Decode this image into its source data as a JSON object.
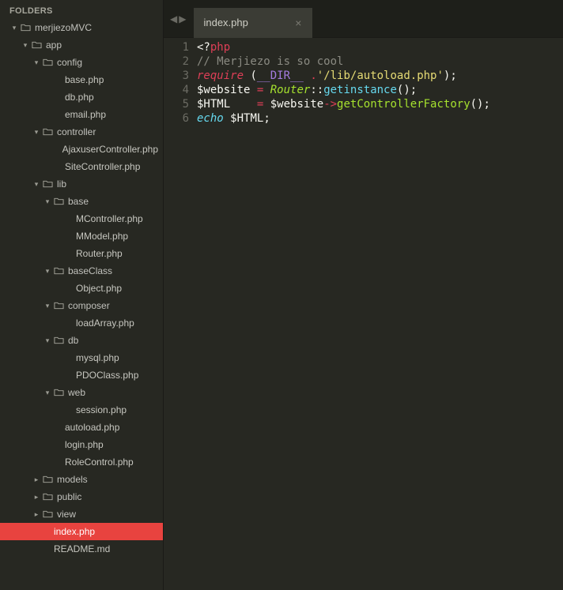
{
  "sidebar": {
    "header": "FOLDERS",
    "tree": [
      {
        "type": "folder",
        "open": true,
        "depth": 0,
        "label": "merjiezoMVC"
      },
      {
        "type": "folder",
        "open": true,
        "depth": 1,
        "label": "app"
      },
      {
        "type": "folder",
        "open": true,
        "depth": 2,
        "label": "config"
      },
      {
        "type": "file",
        "depth": 3,
        "label": "base.php"
      },
      {
        "type": "file",
        "depth": 3,
        "label": "db.php"
      },
      {
        "type": "file",
        "depth": 3,
        "label": "email.php"
      },
      {
        "type": "folder",
        "open": true,
        "depth": 2,
        "label": "controller"
      },
      {
        "type": "file",
        "depth": 3,
        "label": "AjaxuserController.php"
      },
      {
        "type": "file",
        "depth": 3,
        "label": "SiteController.php"
      },
      {
        "type": "folder",
        "open": true,
        "depth": 2,
        "label": "lib"
      },
      {
        "type": "folder",
        "open": true,
        "depth": 3,
        "label": "base"
      },
      {
        "type": "file",
        "depth": 4,
        "label": "MController.php"
      },
      {
        "type": "file",
        "depth": 4,
        "label": "MModel.php"
      },
      {
        "type": "file",
        "depth": 4,
        "label": "Router.php"
      },
      {
        "type": "folder",
        "open": true,
        "depth": 3,
        "label": "baseClass"
      },
      {
        "type": "file",
        "depth": 4,
        "label": "Object.php"
      },
      {
        "type": "folder",
        "open": true,
        "depth": 3,
        "label": "composer"
      },
      {
        "type": "file",
        "depth": 4,
        "label": "loadArray.php"
      },
      {
        "type": "folder",
        "open": true,
        "depth": 3,
        "label": "db"
      },
      {
        "type": "file",
        "depth": 4,
        "label": "mysql.php"
      },
      {
        "type": "file",
        "depth": 4,
        "label": "PDOClass.php"
      },
      {
        "type": "folder",
        "open": true,
        "depth": 3,
        "label": "web"
      },
      {
        "type": "file",
        "depth": 4,
        "label": "session.php"
      },
      {
        "type": "file",
        "depth": 3,
        "label": "autoload.php"
      },
      {
        "type": "file",
        "depth": 3,
        "label": "login.php"
      },
      {
        "type": "file",
        "depth": 3,
        "label": "RoleControl.php"
      },
      {
        "type": "folder",
        "open": false,
        "depth": 2,
        "label": "models"
      },
      {
        "type": "folder",
        "open": false,
        "depth": 2,
        "label": "public"
      },
      {
        "type": "folder",
        "open": false,
        "depth": 2,
        "label": "view"
      },
      {
        "type": "file",
        "depth": 2,
        "label": "index.php",
        "selected": true
      },
      {
        "type": "file",
        "depth": 2,
        "label": "README.md"
      }
    ]
  },
  "tab": {
    "label": "index.php",
    "close_glyph": "×"
  },
  "nav": {
    "back_glyph": "◀",
    "forward_glyph": "▶"
  },
  "code": {
    "line_numbers": [
      "1",
      "2",
      "3",
      "4",
      "5",
      "6"
    ],
    "lines": [
      {
        "tokens": [
          {
            "t": "<?",
            "c": "tok-php"
          },
          {
            "t": "php",
            "c": "tok-keyword2"
          }
        ]
      },
      {
        "tokens": [
          {
            "t": "// Merjiezo is so cool",
            "c": "tok-comment"
          }
        ]
      },
      {
        "tokens": [
          {
            "t": "require",
            "c": "tok-keyword"
          },
          {
            "t": " (",
            "c": "tok-punct"
          },
          {
            "t": "__DIR__",
            "c": "tok-const"
          },
          {
            "t": " ",
            "c": ""
          },
          {
            "t": ".",
            "c": "tok-op"
          },
          {
            "t": "'/lib/autoload.php'",
            "c": "tok-string"
          },
          {
            "t": ");",
            "c": "tok-punct"
          }
        ]
      },
      {
        "tokens": [
          {
            "t": "$website",
            "c": "tok-var"
          },
          {
            "t": " ",
            "c": ""
          },
          {
            "t": "=",
            "c": "tok-op"
          },
          {
            "t": " ",
            "c": ""
          },
          {
            "t": "Router",
            "c": "tok-class"
          },
          {
            "t": "::",
            "c": "tok-punct"
          },
          {
            "t": "getinstance",
            "c": "tok-func"
          },
          {
            "t": "();",
            "c": "tok-punct"
          }
        ]
      },
      {
        "tokens": [
          {
            "t": "$HTML",
            "c": "tok-var"
          },
          {
            "t": "    ",
            "c": ""
          },
          {
            "t": "=",
            "c": "tok-op"
          },
          {
            "t": " ",
            "c": ""
          },
          {
            "t": "$website",
            "c": "tok-var"
          },
          {
            "t": "->",
            "c": "tok-op"
          },
          {
            "t": "getControllerFactory",
            "c": "tok-func2"
          },
          {
            "t": "();",
            "c": "tok-punct"
          }
        ]
      },
      {
        "tokens": [
          {
            "t": "echo",
            "c": "tok-echo"
          },
          {
            "t": " ",
            "c": ""
          },
          {
            "t": "$HTML",
            "c": "tok-var"
          },
          {
            "t": ";",
            "c": "tok-punct"
          }
        ]
      }
    ]
  }
}
